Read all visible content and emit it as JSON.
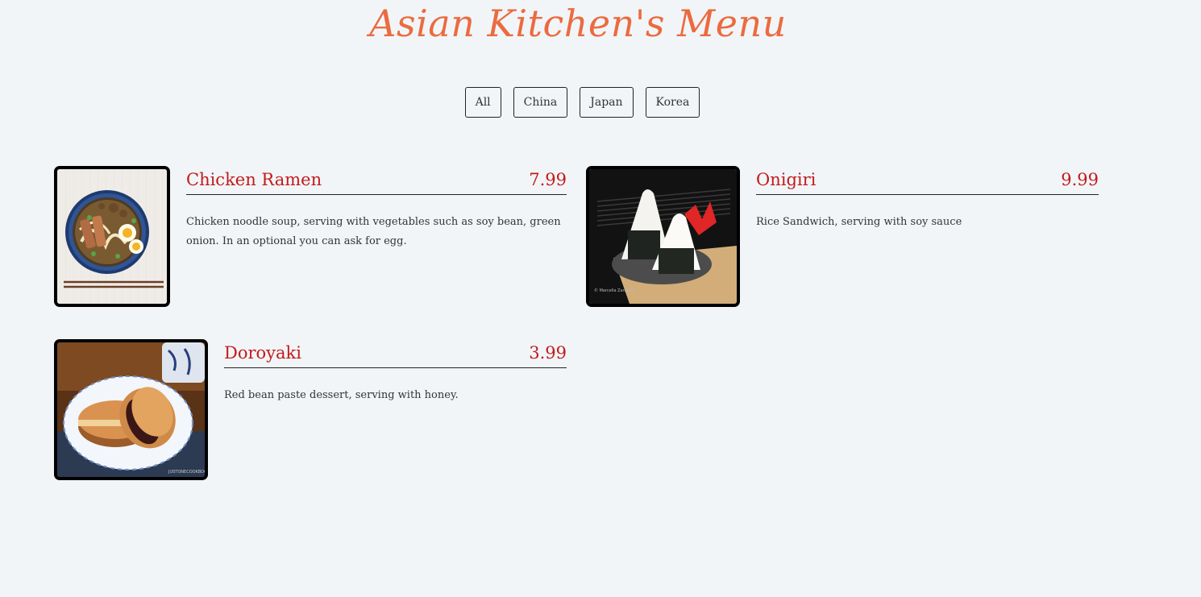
{
  "header": {
    "title": "Asian Kitchen's Menu"
  },
  "filters": [
    "All",
    "China",
    "Japan",
    "Korea"
  ],
  "items": [
    {
      "name": "Chicken Ramen",
      "price": "7.99",
      "description": "Chicken noodle soup, serving with vegetables such as soy bean, green onion. In an optional you can ask for egg."
    },
    {
      "name": "Onigiri",
      "price": "9.99",
      "description": "Rice Sandwich, serving with soy sauce"
    },
    {
      "name": "Doroyaki",
      "price": "3.99",
      "description": "Red bean paste dessert, serving with honey."
    }
  ],
  "colors": {
    "background": "#f1f5f8",
    "title": "#eb6b3f",
    "accent": "#c41a1a"
  }
}
